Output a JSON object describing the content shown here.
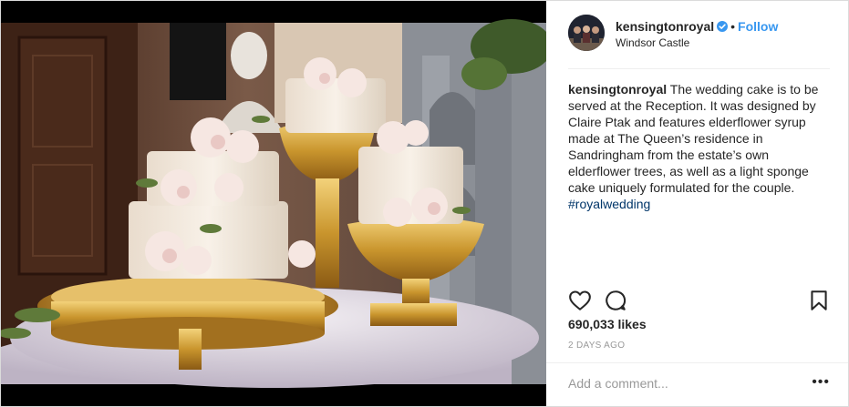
{
  "post": {
    "username": "kensingtonroyal",
    "separator": "•",
    "follow_label": "Follow",
    "location": "Windsor Castle",
    "caption_user": "kensingtonroyal",
    "caption_text": " The wedding cake is to be served at the Reception. It was designed by Claire Ptak and features elderflower syrup made at The Queen’s residence in Sandringham from the estate’s own elderflower trees, as well as a light sponge cake uniquely formulated for the couple.",
    "hashtag": "#royalwedding",
    "likes": "690,033 likes",
    "timestamp": "2 DAYS AGO",
    "comment_placeholder": "Add a comment...",
    "more_label": "•••"
  },
  "icons": {
    "verified": "verified-badge-icon",
    "like": "heart-icon",
    "comment": "comment-bubble-icon",
    "save": "bookmark-icon"
  },
  "colors": {
    "link_blue": "#3897f0",
    "hashtag_blue": "#003569",
    "text": "#262626",
    "muted": "#999999"
  }
}
